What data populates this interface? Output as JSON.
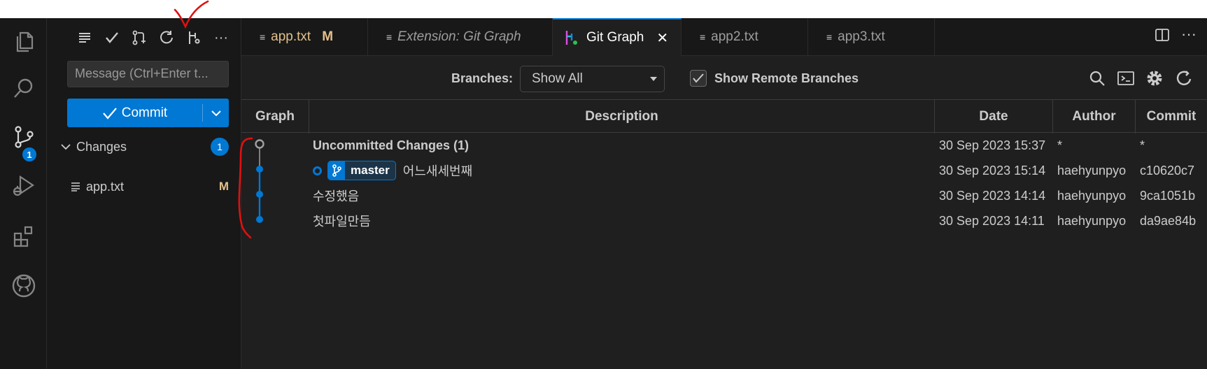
{
  "activity_bar": {
    "items": [
      {
        "name": "explorer",
        "icon": "files-icon"
      },
      {
        "name": "search",
        "icon": "search-icon"
      },
      {
        "name": "source-control",
        "icon": "source-control-icon",
        "badge": "1"
      },
      {
        "name": "run-debug",
        "icon": "run-debug-icon"
      },
      {
        "name": "extensions",
        "icon": "extensions-icon"
      },
      {
        "name": "github",
        "icon": "github-icon"
      }
    ]
  },
  "scm": {
    "toolbar_icons": [
      "list-view-icon",
      "check-icon",
      "pull-request-icon",
      "refresh-icon",
      "git-graph-icon",
      "more-icon"
    ],
    "message_placeholder": "Message (Ctrl+Enter t...",
    "commit_label": "Commit",
    "changes_label": "Changes",
    "changes_count": "1",
    "files": [
      {
        "name": "app.txt",
        "status": "M"
      }
    ]
  },
  "tabs": [
    {
      "label": "app.txt",
      "modified": "M",
      "active": false,
      "italic": false
    },
    {
      "label": "Extension: Git Graph",
      "active": false,
      "italic": true
    },
    {
      "label": "Git Graph",
      "active": true,
      "italic": false,
      "close": "✕"
    },
    {
      "label": "app2.txt",
      "active": false,
      "italic": false
    },
    {
      "label": "app3.txt",
      "active": false,
      "italic": false
    }
  ],
  "git_graph": {
    "branches_label": "Branches:",
    "branches_value": "Show All",
    "show_remote_label": "Show Remote Branches",
    "show_remote_checked": true,
    "columns": {
      "graph": "Graph",
      "description": "Description",
      "date": "Date",
      "author": "Author",
      "commit": "Commit"
    },
    "rows": [
      {
        "description": "Uncommitted Changes (1)",
        "date": "30 Sep 2023 15:37",
        "author": "*",
        "commit": "*",
        "uncommitted": true
      },
      {
        "branch": "master",
        "description": "어느새세번째",
        "date": "30 Sep 2023 15:14",
        "author": "haehyunpyo",
        "commit": "c10620c7"
      },
      {
        "description": "수정했음",
        "date": "30 Sep 2023 14:14",
        "author": "haehyunpyo",
        "commit": "9ca1051b"
      },
      {
        "description": "첫파일만듬",
        "date": "30 Sep 2023 14:11",
        "author": "haehyunpyo",
        "commit": "da9ae84b"
      }
    ]
  },
  "colors": {
    "accent": "#0078d4",
    "modified": "#e2c08d",
    "annotation": "#e01010"
  }
}
